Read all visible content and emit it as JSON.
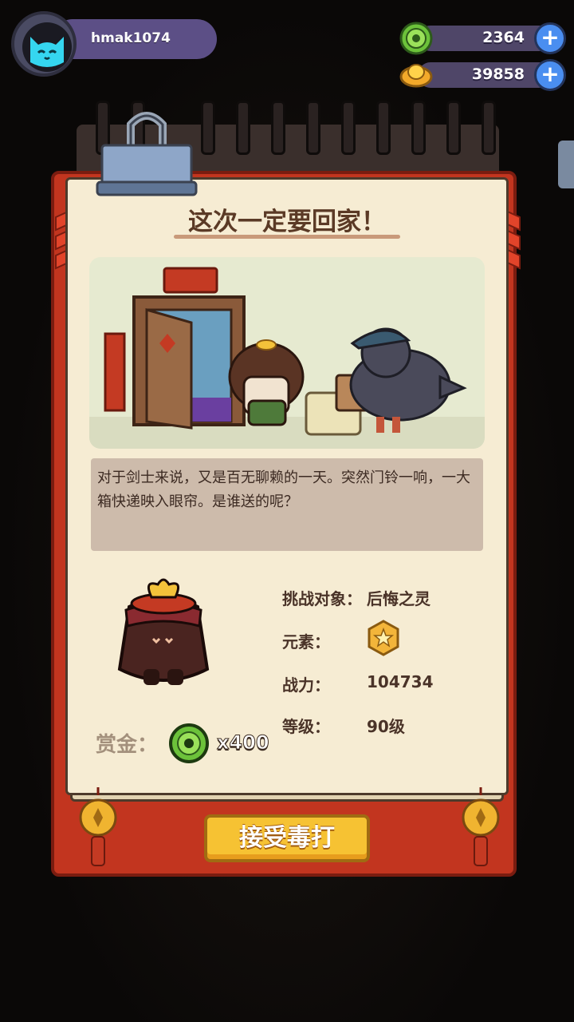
{
  "player": {
    "username": "hmak1074"
  },
  "currencies": [
    {
      "name": "jade-coin",
      "value": "2364"
    },
    {
      "name": "gold-ingot",
      "value": "39858"
    }
  ],
  "plus_symbol": "+",
  "quest": {
    "title": "这次一定要回家！",
    "description": "对于剑士来说，又是百无聊赖的一天。突然门铃一响，一大箱快递映入眼帘。是谁送的呢？",
    "stats": {
      "target_label": "挑战对象：",
      "target_value": "后悔之灵",
      "element_label": "元素：",
      "power_label": "战力：",
      "power_value": "104734",
      "level_label": "等级：",
      "level_value": "90级"
    },
    "reward": {
      "label": "赏金：",
      "count": "x400"
    },
    "accept_button": "接受毒打"
  },
  "colors": {
    "accent_red": "#c2351f",
    "button_yellow": "#f6c233",
    "page": "#f6ecd3"
  }
}
